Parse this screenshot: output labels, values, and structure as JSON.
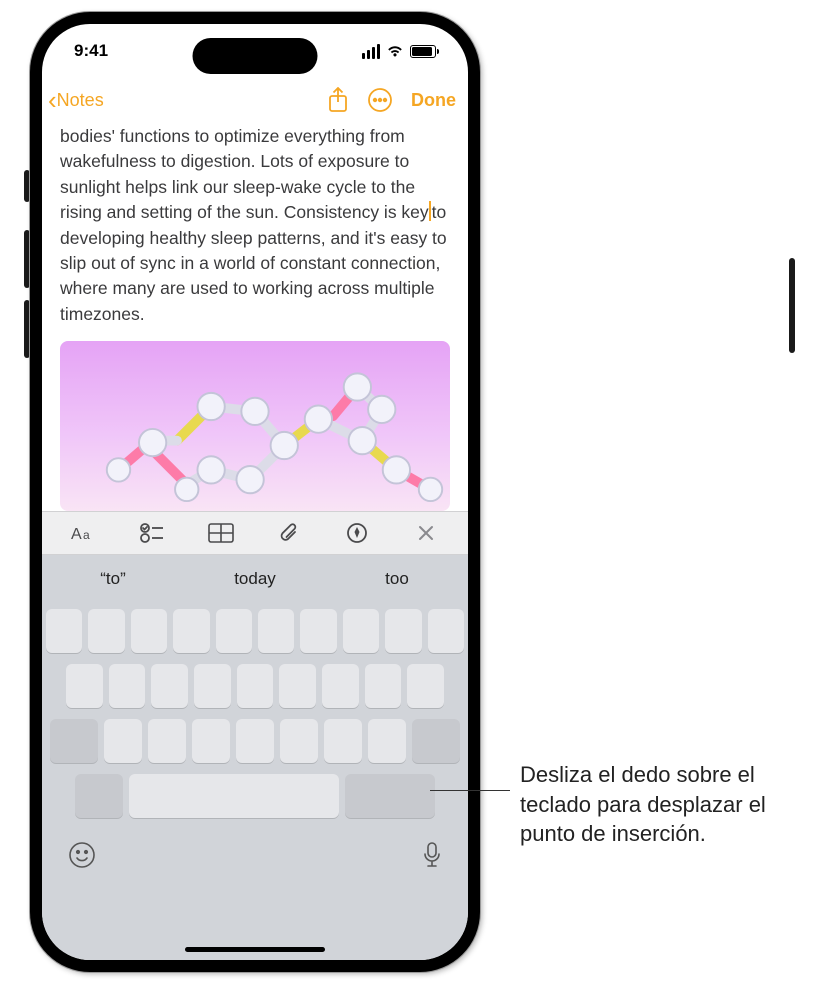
{
  "status": {
    "time": "9:41"
  },
  "nav": {
    "back_label": "Notes",
    "done_label": "Done"
  },
  "note": {
    "text_before_cursor": "bodies' functions to optimize everything from wakefulness to digestion. Lots of exposure to sunlight helps link our sleep-wake cycle to the rising and setting of the sun. Consistency is key",
    "text_after_cursor": "to developing healthy sleep patterns, and it's easy to slip out of sync in a world of constant connection, where many are used to working across multiple timezones."
  },
  "suggestions": {
    "items": [
      "“to”",
      "today",
      "too"
    ]
  },
  "callout": {
    "text": "Desliza el dedo sobre el teclado para desplazar el punto de inserción."
  },
  "colors": {
    "accent": "#f5a623"
  }
}
